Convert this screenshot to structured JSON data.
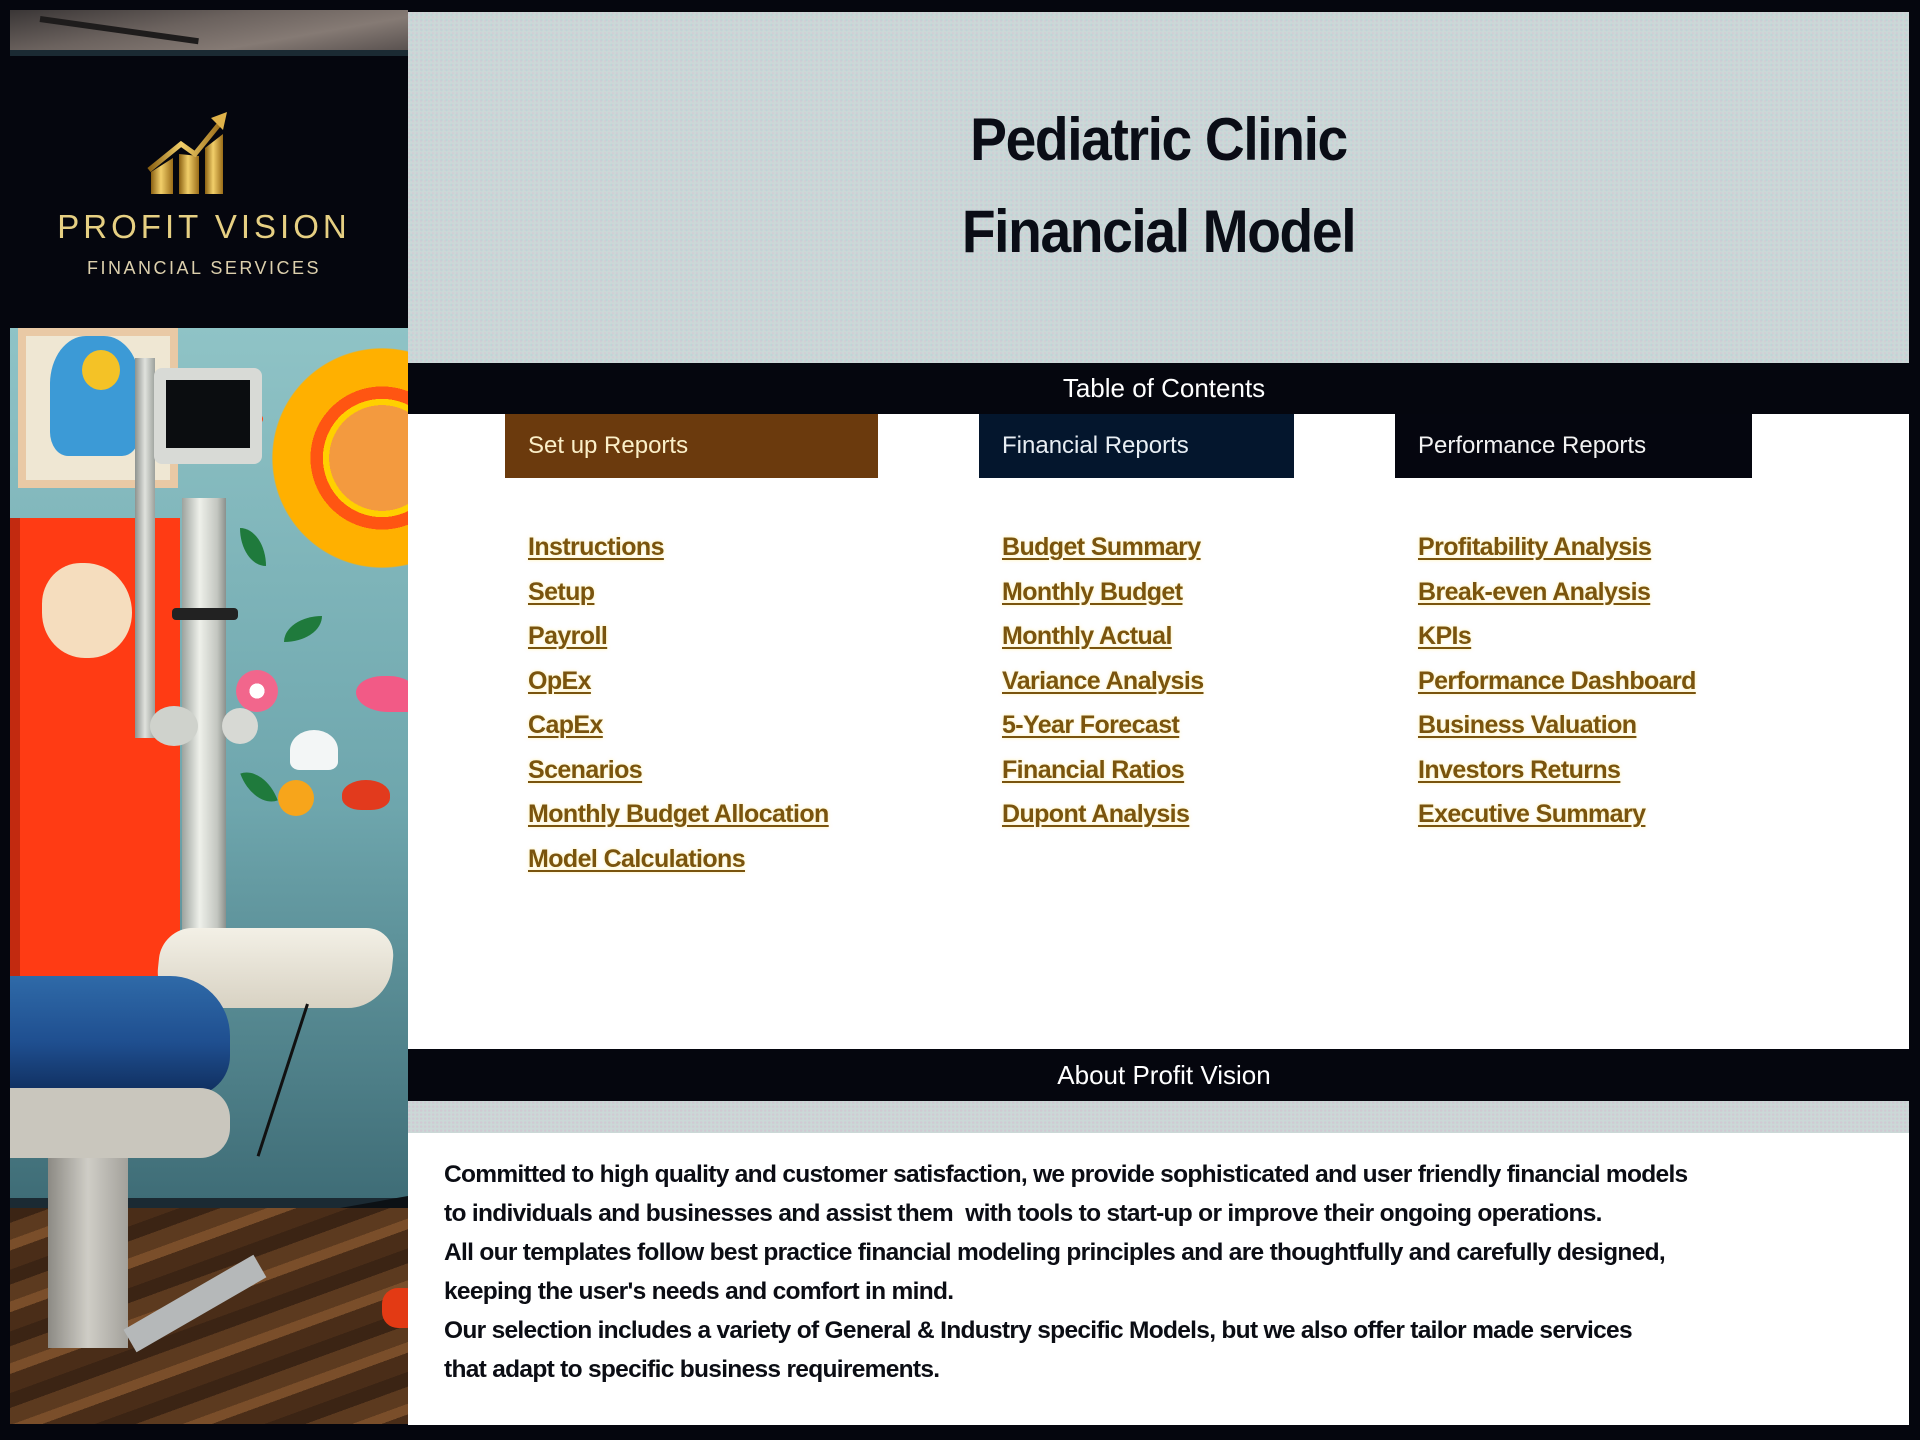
{
  "brand": {
    "name": "PROFIT VISION",
    "tagline": "FINANCIAL SERVICES",
    "logo_icon": "rising-bar-chart-arrow-icon",
    "gold": "#e6cf82"
  },
  "header": {
    "title_line1": "Pediatric Clinic",
    "title_line2": "Financial Model"
  },
  "toc": {
    "title": "Table of Contents",
    "columns": [
      {
        "heading": "Set up Reports",
        "color": "#6b3a0d",
        "links": [
          "Instructions",
          "Setup",
          "Payroll",
          "OpEx",
          "CapEx",
          "Scenarios",
          "Monthly Budget Allocation",
          "Model Calculations"
        ]
      },
      {
        "heading": "Financial Reports",
        "color": "#04162d",
        "links": [
          "Budget Summary",
          "Monthly Budget",
          "Monthly Actual",
          "Variance Analysis",
          "5-Year Forecast",
          "Financial Ratios",
          "Dupont Analysis"
        ]
      },
      {
        "heading": "Performance Reports",
        "color": "#05060f",
        "links": [
          "Profitability Analysis",
          "Break-even Analysis",
          "KPIs",
          "Performance Dashboard",
          "Business Valuation",
          "Investors Returns",
          "Executive Summary"
        ]
      }
    ],
    "link_color": "#7a540e"
  },
  "about": {
    "title": "About Profit Vision",
    "lines": [
      "Committed to high quality and customer satisfaction, we provide sophisticated and user friendly financial models",
      "to individuals and businesses and assist them  with tools to start-up or improve their ongoing operations.",
      "All our templates follow best practice financial modeling principles and are thoughtfully and carefully designed,",
      "keeping the user's needs and comfort in mind.",
      "Our selection includes a variety of General & Industry specific Models, but we also offer tailor made services",
      "that adapt to specific business requirements."
    ]
  },
  "sidebar_image": {
    "description": "pediatric clinic exam room with colorful wall decorations, medical equipment and blue exam chair"
  }
}
